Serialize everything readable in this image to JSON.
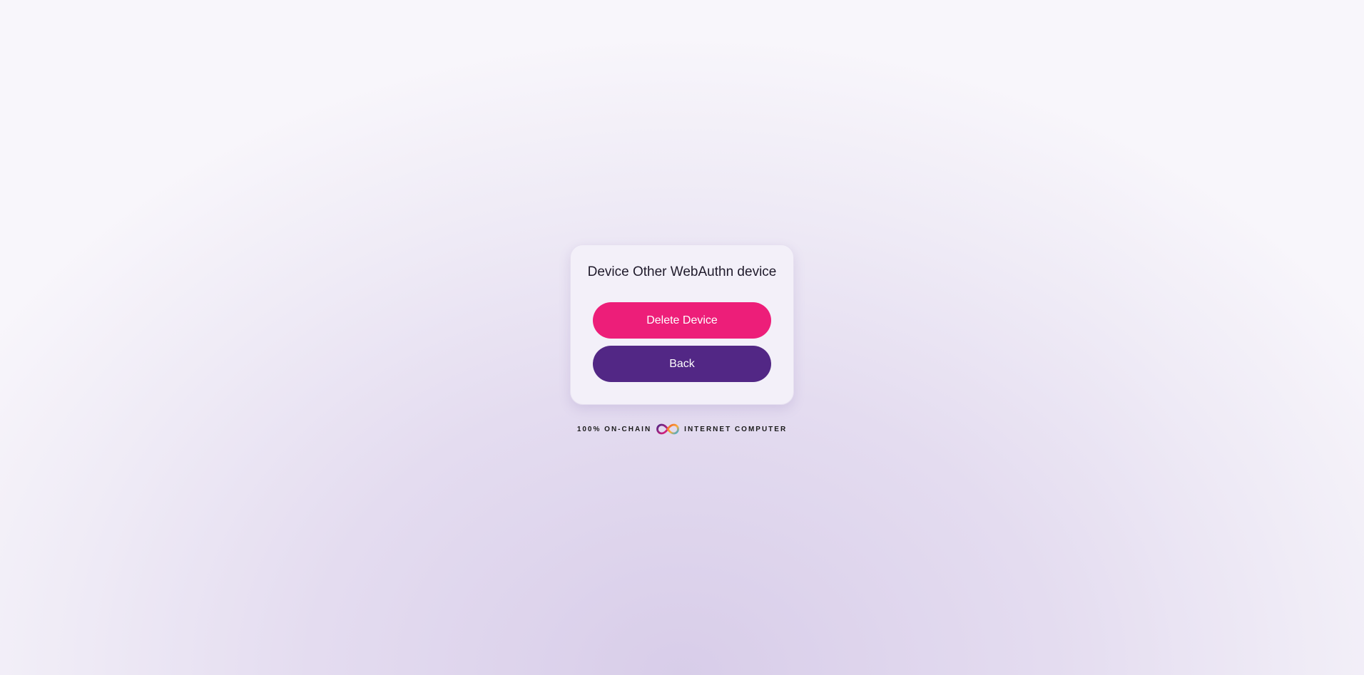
{
  "card": {
    "title": "Device Other WebAuthn device",
    "delete_button_label": "Delete Device",
    "back_button_label": "Back"
  },
  "footer": {
    "left_text": "100% ON-CHAIN",
    "right_text": "INTERNET COMPUTER",
    "logo_icon": "infinity-icon"
  },
  "colors": {
    "delete_button": "#ed1e79",
    "back_button": "#522785",
    "logo_pink": "#ed1e79",
    "logo_purple": "#522785",
    "logo_orange": "#f15a24",
    "logo_blue": "#29abe2"
  }
}
